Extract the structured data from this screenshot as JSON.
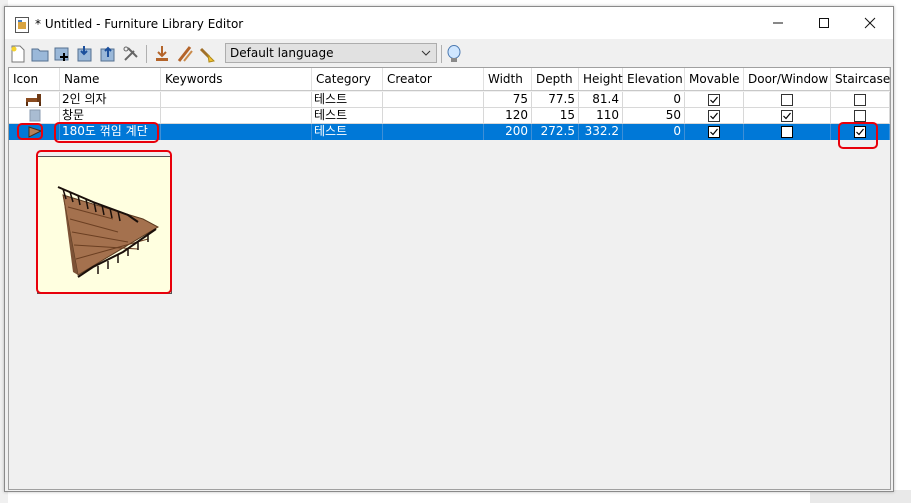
{
  "window": {
    "title": "* Untitled - Furniture Library Editor",
    "minimize_glyph": "—",
    "maximize_glyph": "☐",
    "close_glyph": "✕"
  },
  "toolbar": {
    "icons": [
      "new-icon",
      "open-icon",
      "add-furniture-icon",
      "import-icon",
      "export-icon",
      "settings-icon",
      "import-furniture-icon",
      "modify-icon",
      "delete-icon"
    ],
    "language_select": "Default language",
    "tip_icon": "lightbulb-icon"
  },
  "table": {
    "columns": [
      "Icon",
      "Name",
      "Keywords",
      "Category",
      "Creator",
      "Width",
      "Depth",
      "Height",
      "Elevation",
      "Movable",
      "Door/Window",
      "Staircase"
    ],
    "rows": [
      {
        "icon": "chair-icon",
        "name": "2인 의자",
        "keywords": "",
        "category": "테스트",
        "creator": "",
        "width": "75",
        "depth": "77.5",
        "height": "81.4",
        "elevation": "0",
        "movable": true,
        "door_window": false,
        "staircase": false,
        "selected": false
      },
      {
        "icon": "window-icon",
        "name": "창문",
        "keywords": "",
        "category": "테스트",
        "creator": "",
        "width": "120",
        "depth": "15",
        "height": "110",
        "elevation": "50",
        "movable": true,
        "door_window": true,
        "staircase": false,
        "selected": false
      },
      {
        "icon": "staircase-icon",
        "name": "180도 꺾임 계단",
        "keywords": "",
        "category": "테스트",
        "creator": "",
        "width": "200",
        "depth": "272.5",
        "height": "332.2",
        "elevation": "0",
        "movable": true,
        "door_window": false,
        "staircase": true,
        "selected": true
      }
    ]
  },
  "preview": {
    "icon": "staircase-preview"
  },
  "colors": {
    "selection": "#0078d7",
    "highlight": "#e8000b",
    "preview_bg": "#ffffe0"
  }
}
